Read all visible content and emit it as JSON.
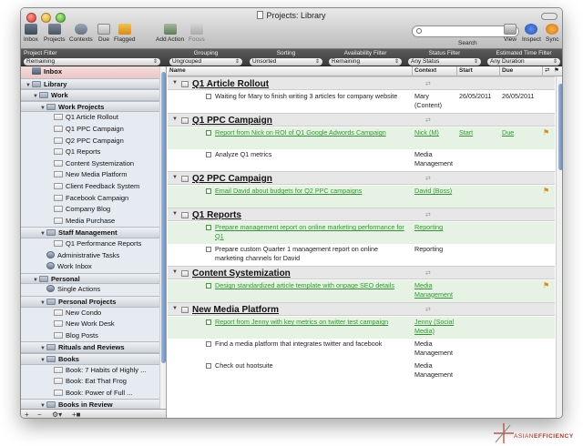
{
  "window": {
    "title": "Projects: Library"
  },
  "toolbar": {
    "inbox": "Inbox",
    "projects": "Projects",
    "contexts": "Contexts",
    "due": "Due",
    "flagged": "Flagged",
    "add_action": "Add Action",
    "focus": "Focus",
    "search_label": "Search",
    "view": "View",
    "inspect": "Inspect",
    "sync": "Sync"
  },
  "filters": {
    "project_filter": {
      "label": "Project Filter",
      "value": "Remaining"
    },
    "grouping": {
      "label": "Grouping",
      "value": "Ungrouped"
    },
    "sorting": {
      "label": "Sorting",
      "value": "Unsorted"
    },
    "availability": {
      "label": "Availability Filter",
      "value": "Remaining"
    },
    "status": {
      "label": "Status Filter",
      "value": "Any Status"
    },
    "time": {
      "label": "Estimated Time Filter",
      "value": "Any Duration"
    }
  },
  "sidebar": {
    "items": [
      {
        "label": "Inbox",
        "kind": "inbox",
        "level": 0
      },
      {
        "label": "Library",
        "kind": "group",
        "level": 0
      },
      {
        "label": "Work",
        "kind": "folder",
        "level": 1
      },
      {
        "label": "Work Projects",
        "kind": "folder",
        "level": 2
      },
      {
        "label": "Q1 Article Rollout",
        "kind": "project",
        "level": 3
      },
      {
        "label": "Q1 PPC Campaign",
        "kind": "project",
        "level": 3
      },
      {
        "label": "Q2 PPC Campaign",
        "kind": "project",
        "level": 3
      },
      {
        "label": "Q1 Reports",
        "kind": "project",
        "level": 3
      },
      {
        "label": "Content Systemization",
        "kind": "project",
        "level": 3
      },
      {
        "label": "New Media Platform",
        "kind": "project",
        "level": 3
      },
      {
        "label": "Client Feedback System",
        "kind": "project",
        "level": 3
      },
      {
        "label": "Facebook Campaign",
        "kind": "project",
        "level": 3
      },
      {
        "label": "Company Blog",
        "kind": "project",
        "level": 3
      },
      {
        "label": "Media Purchase",
        "kind": "project",
        "level": 3
      },
      {
        "label": "Staff Management",
        "kind": "folder",
        "level": 2
      },
      {
        "label": "Q1 Performance Reports",
        "kind": "project",
        "level": 3
      },
      {
        "label": "Administrative Tasks",
        "kind": "context",
        "level": 2
      },
      {
        "label": "Work Inbox",
        "kind": "context",
        "level": 2
      },
      {
        "label": "Personal",
        "kind": "folder",
        "level": 1
      },
      {
        "label": "Single Actions",
        "kind": "context",
        "level": 2
      },
      {
        "label": "Personal Projects",
        "kind": "folder",
        "level": 2
      },
      {
        "label": "New Condo",
        "kind": "project",
        "level": 3
      },
      {
        "label": "New Work Desk",
        "kind": "project",
        "level": 3
      },
      {
        "label": "Blog Posts",
        "kind": "project",
        "level": 3
      },
      {
        "label": "Rituals and Reviews",
        "kind": "folder",
        "level": 2
      },
      {
        "label": "Books",
        "kind": "folder",
        "level": 2
      },
      {
        "label": "Book: 7 Habits of Highly ...",
        "kind": "project",
        "level": 3
      },
      {
        "label": "Book: Eat That Frog",
        "kind": "project",
        "level": 3
      },
      {
        "label": "Book: Power of Full ...",
        "kind": "project",
        "level": 3
      },
      {
        "label": "Books in Review",
        "kind": "folder",
        "level": 2
      }
    ],
    "footer": {
      "add": "+",
      "remove": "−",
      "gear": "⚙▾",
      "add_folder": "+■"
    }
  },
  "columns": {
    "name": "Name",
    "context": "Context",
    "start": "Start",
    "due": "Due"
  },
  "projects": [
    {
      "title": "Q1 Article Rollout",
      "actions": [
        {
          "name": "Waiting for Mary to finish writing 3 articles for company website",
          "context": "Mary (Content)",
          "start": "26/05/2011",
          "due": "26/05/2011",
          "highlight": false,
          "flagged": false
        }
      ]
    },
    {
      "title": "Q1 PPC Campaign",
      "actions": [
        {
          "name": "Report from Nick on ROI of Q1 Google Adwords Campaign",
          "context": "Nick (M)",
          "start": "Start",
          "due": "Due",
          "highlight": true,
          "flagged": true
        },
        {
          "name": "Analyze Q1 metrics",
          "context": "Media Management",
          "start": "",
          "due": "",
          "highlight": false,
          "flagged": false
        }
      ]
    },
    {
      "title": "Q2 PPC Campaign",
      "actions": [
        {
          "name": "Email David about budgets for Q2 PPC campaigns",
          "context": "David (Boss)",
          "start": "",
          "due": "",
          "highlight": true,
          "flagged": true
        }
      ]
    },
    {
      "title": "Q1 Reports",
      "actions": [
        {
          "name": "Prepare management report on online marketing performance for Q1",
          "context": "Reporting",
          "start": "",
          "due": "",
          "highlight": true,
          "flagged": false
        },
        {
          "name": "Prepare custom Quarter 1 management report on online marketing channels for David",
          "context": "Reporting",
          "start": "",
          "due": "",
          "highlight": false,
          "flagged": false
        }
      ]
    },
    {
      "title": "Content Systemization",
      "actions": [
        {
          "name": "Design standardized article template with onpage SEO details",
          "context": "Media Management",
          "start": "",
          "due": "",
          "highlight": true,
          "flagged": true
        }
      ]
    },
    {
      "title": "New Media Platform",
      "actions": [
        {
          "name": "Report from Jenny with key metrics on twitter test campaign",
          "context": "Jenny (Social Media)",
          "start": "",
          "due": "",
          "highlight": true,
          "flagged": false
        },
        {
          "name": "Find a media platform that integrates twitter and facebook",
          "context": "Media Management",
          "start": "",
          "due": "",
          "highlight": false,
          "flagged": false
        },
        {
          "name": "Check out hootsuite",
          "context": "Media Management",
          "start": "",
          "due": "",
          "highlight": false,
          "flagged": false
        }
      ]
    }
  ],
  "branding": {
    "logo_text_1": "ASIAN",
    "logo_text_2": "EFFICIENCY",
    "accent": "#b53a2a"
  },
  "colors": {
    "highlight_row": "#e6f2e3",
    "highlight_text": "#2e9a2e",
    "flag": "#e28a14"
  }
}
